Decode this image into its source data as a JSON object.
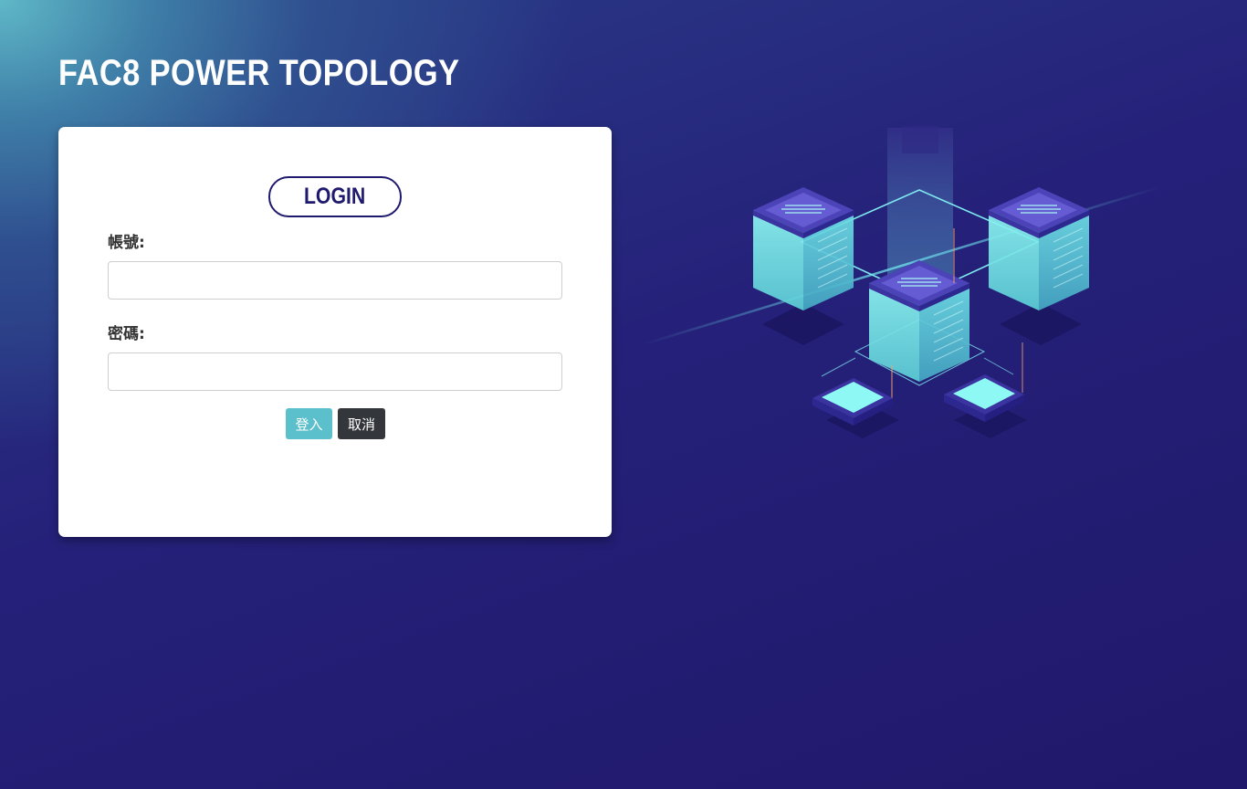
{
  "app": {
    "title": "FAC8 POWER TOPOLOGY"
  },
  "login_form": {
    "heading": "LOGIN",
    "username_label": "帳號:",
    "username_value": "",
    "password_label": "密碼:",
    "password_value": "",
    "submit_label": "登入",
    "cancel_label": "取消"
  },
  "illustration": {
    "icon": "server-network-illustration"
  },
  "colors": {
    "background_dark": "#20186a",
    "background_light": "#5fb8c7",
    "heading_accent": "#1f1a6e",
    "submit_button": "#5bc0cc",
    "cancel_button": "#33363a",
    "server_glow": "#7ff0f0"
  }
}
